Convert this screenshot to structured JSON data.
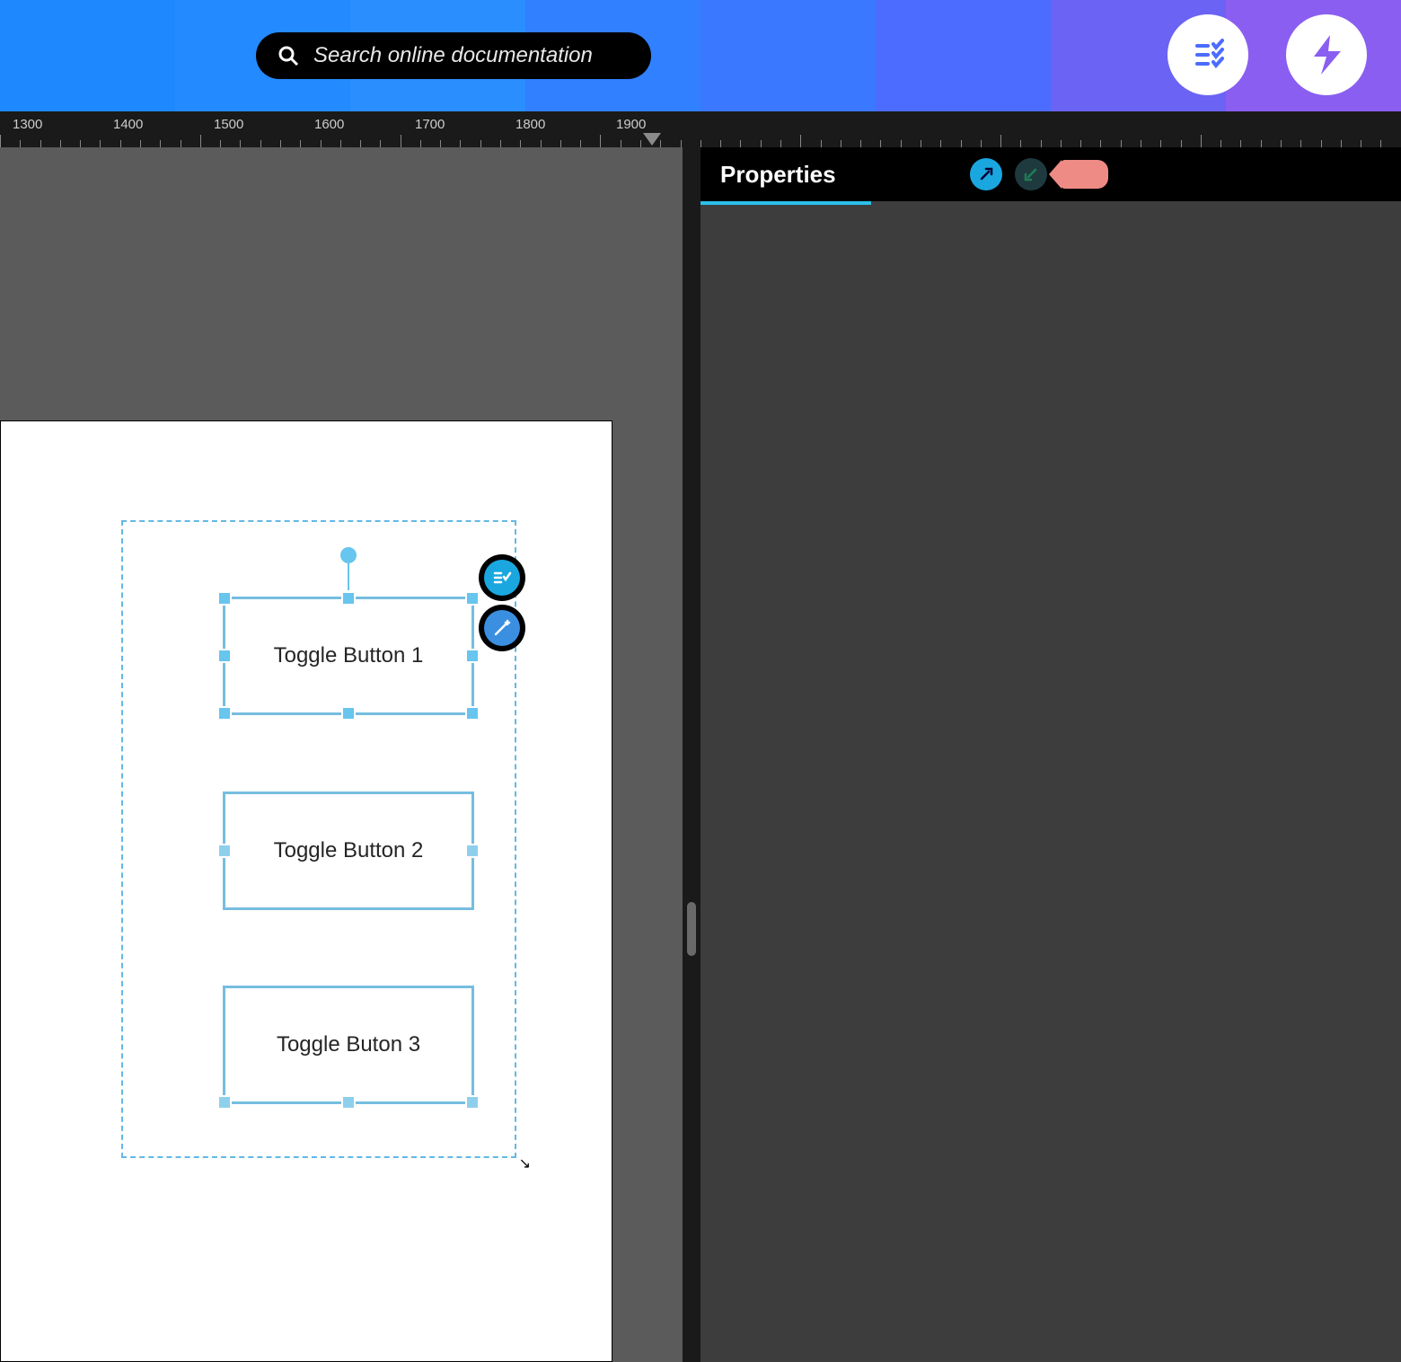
{
  "topbar": {
    "search_placeholder": "Search online documentation"
  },
  "ruler": {
    "marks": [
      "1300",
      "1400",
      "1500",
      "1600",
      "1700",
      "1800",
      "1900"
    ]
  },
  "canvas": {
    "buttons": [
      {
        "label": "Toggle Button 1"
      },
      {
        "label": "Toggle Button 2"
      },
      {
        "label": "Toggle Buton 3"
      }
    ]
  },
  "panel": {
    "title": "Properties"
  }
}
